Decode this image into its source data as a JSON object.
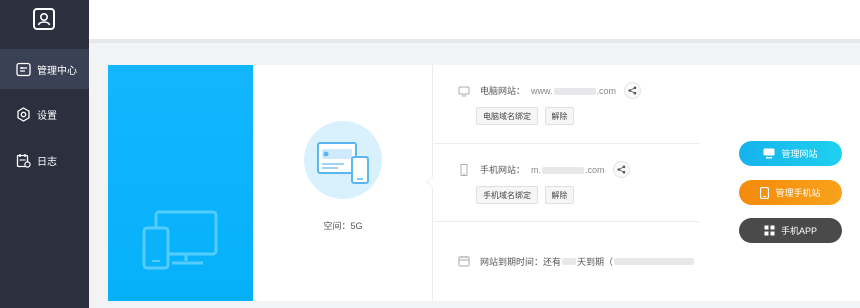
{
  "sidebar": {
    "items": [
      {
        "label": "管理中心",
        "icon": "dashboard-icon",
        "active": true
      },
      {
        "label": "设置",
        "icon": "gear-icon",
        "active": false
      },
      {
        "label": "日志",
        "icon": "calendar-log-icon",
        "active": false
      }
    ]
  },
  "site": {
    "space_label": "空间：5G",
    "pc_label": "电脑网站：",
    "pc_url_prefix": "www.",
    "pc_url_suffix": ".com",
    "pc_bind_button": "电脑域名绑定",
    "pc_unbind_button": "解除",
    "mobile_label": "手机网站：",
    "mobile_url_prefix": "m.",
    "mobile_url_suffix": ".com",
    "mobile_bind_button": "手机域名绑定",
    "mobile_unbind_button": "解除",
    "expire_text": "网站到期时间：还有",
    "expire_suffix": "天到期（"
  },
  "actions": {
    "manage_site": "管理网站",
    "manage_mobile": "管理手机站",
    "mobile_app": "手机APP"
  },
  "colors": {
    "sidebar_bg": "#2b2f3e",
    "accent_blue": "#06b1fa",
    "cyan_button": "#17c2ec",
    "orange_button": "#f7940d",
    "dark_button": "#4a4a4a"
  }
}
